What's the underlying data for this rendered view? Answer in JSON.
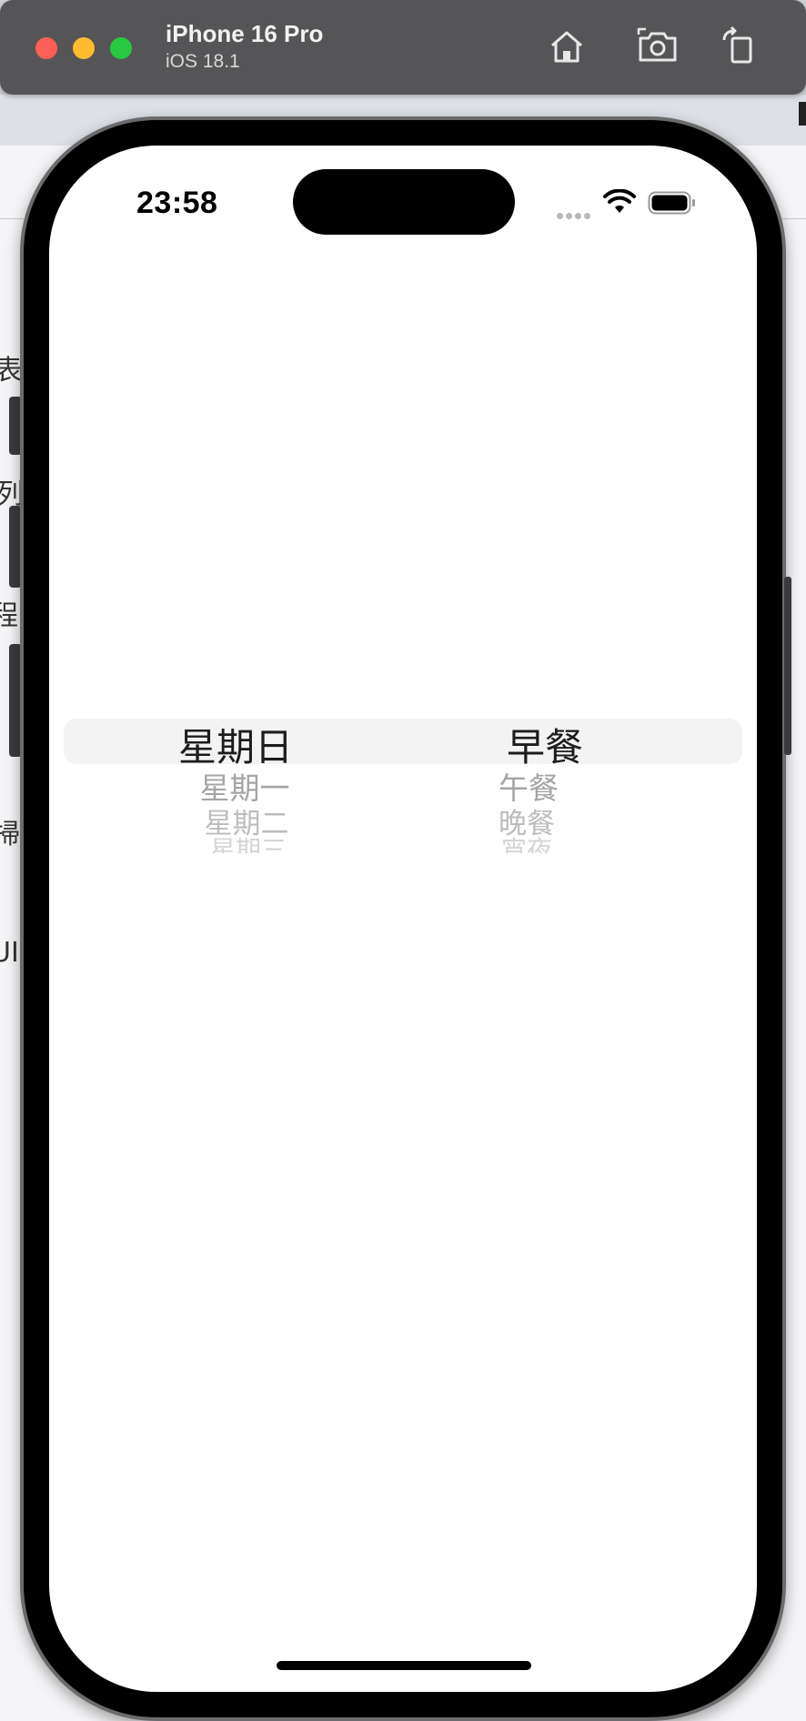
{
  "simulator": {
    "device_name": "iPhone 16 Pro",
    "os_version": "iOS 18.1",
    "toolbar_icons": [
      "home-icon",
      "screenshot-icon",
      "rotate-icon"
    ]
  },
  "background_fragments": [
    "表者",
    "列",
    "程",
    "掃器",
    "UI"
  ],
  "status_bar": {
    "time": "23:58"
  },
  "picker": {
    "columns": [
      {
        "name": "weekday",
        "selected": "星期日",
        "below": [
          "星期一",
          "星期二",
          "星期三"
        ]
      },
      {
        "name": "meal",
        "selected": "早餐",
        "below": [
          "午餐",
          "晚餐",
          "宵夜"
        ]
      }
    ]
  },
  "colors": {
    "toolbar": "#555557",
    "close": "#ff5f57",
    "minimize": "#febc2e",
    "maximize": "#28c840",
    "picker_highlight": "#f3f3f4"
  }
}
